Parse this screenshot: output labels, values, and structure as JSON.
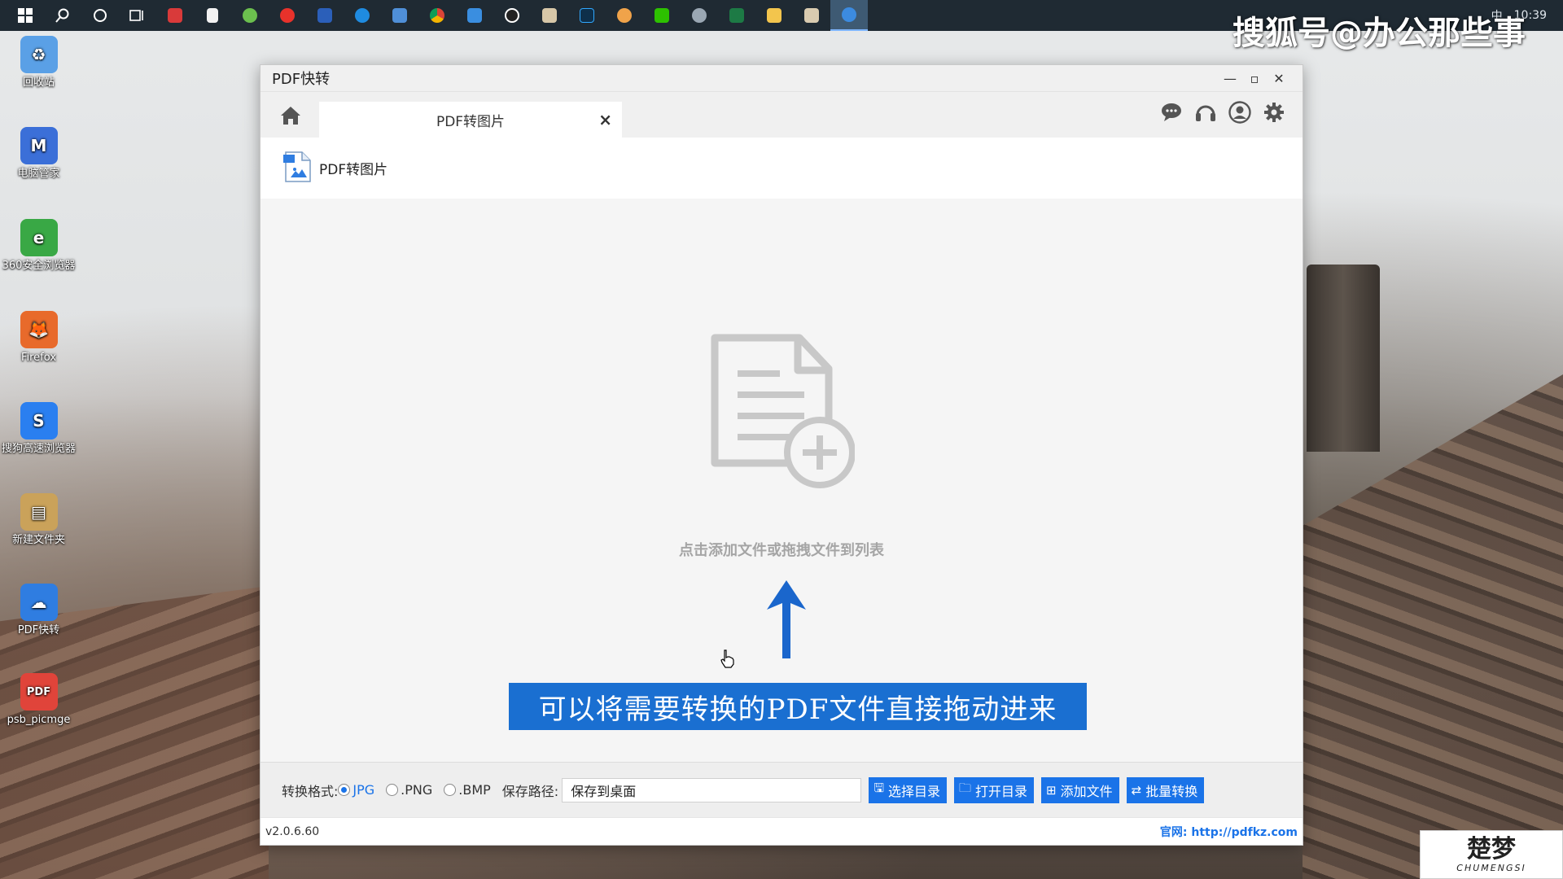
{
  "watermark": "搜狐号@办公那些事",
  "taskbar": {
    "icons": [
      "windows-icon",
      "search-icon",
      "cortana-icon",
      "task-view-icon",
      "app-red-icon",
      "file-icon",
      "app-green-icon",
      "app-weibo-icon",
      "word-icon",
      "edge-icon",
      "app-blue-icon",
      "chrome-icon",
      "app-cloud-icon",
      "qq-icon",
      "app-window-icon",
      "photoshop-icon",
      "app-face-icon",
      "wechat-icon",
      "app-globe-icon",
      "excel-icon",
      "folder-icon",
      "app-box-icon",
      "pdfkz-icon"
    ],
    "tray_lang": "中",
    "tray_time": "10:39"
  },
  "desktop": {
    "icons": [
      {
        "label": "回收站",
        "color": "#5aa0e6",
        "glyph": "♻"
      },
      {
        "label": "电脑管家",
        "color": "#3b6fd8",
        "glyph": "M"
      },
      {
        "label": "360安全浏览器",
        "color": "#39a845",
        "glyph": "e"
      },
      {
        "label": "Firefox",
        "color": "#e86a2b",
        "glyph": "🦊"
      },
      {
        "label": "搜狗高速浏览器",
        "color": "#2a7ff0",
        "glyph": "S"
      },
      {
        "label": "新建文件夹",
        "color": "#caa25a",
        "glyph": "▤"
      },
      {
        "label": "PDF快转",
        "color": "#2f7de1",
        "glyph": "☁"
      },
      {
        "label": "psb_picmge",
        "color": "#e0443a",
        "glyph": "PDF"
      }
    ]
  },
  "window": {
    "title": "PDF快转",
    "tab_label": "PDF转图片",
    "subheader_label": "PDF转图片",
    "drop_hint": "点击添加文件或拖拽文件到列表",
    "caption": "可以将需要转换的PDF文件直接拖动进来",
    "format_label": "转换格式:",
    "formats": [
      {
        "label": "JPG",
        "selected": true
      },
      {
        "label": ".PNG",
        "selected": false
      },
      {
        "label": ".BMP",
        "selected": false
      }
    ],
    "save_path_label": "保存路径:",
    "save_path_value": "保存到桌面",
    "buttons": {
      "select_dir": "选择目录",
      "open_dir": "打开目录",
      "add_file": "添加文件",
      "batch_convert": "批量转换"
    },
    "version": "v2.0.6.60",
    "site_label": "官网:",
    "site_url": "http://pdfkz.com"
  },
  "brand_logo": {
    "main": "楚梦",
    "sub": "CHUMENGSI"
  },
  "colors": {
    "accent": "#1a73e8",
    "caption_bg": "#1a6fd1"
  }
}
